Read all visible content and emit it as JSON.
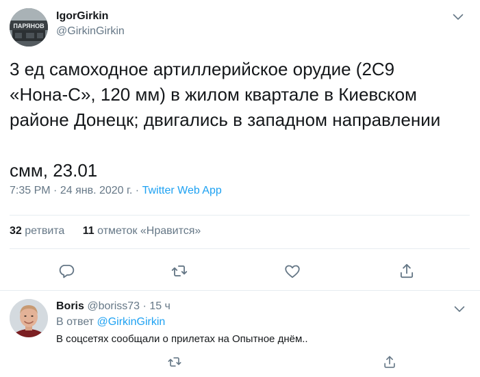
{
  "tweet": {
    "author_name": "IgorGirkin",
    "author_handle": "@GirkinGirkin",
    "avatar_caption": "ПАРЯНОВ",
    "text_lines": [
      "3 ед самоходное артиллерийское орудие (2С9",
      "«Нона-С», 120 мм) в жилом квартале в Киевском",
      "районе Донецк; двигались в западном направлении",
      "смм, 23.01"
    ],
    "time": "7:35 PM",
    "date": "24 янв. 2020 г.",
    "separator": "·",
    "app": "Twitter Web App",
    "retweet_count": "32",
    "retweet_label": "ретвита",
    "like_count": "11",
    "like_label": "отметок «Нравится»"
  },
  "icons": {
    "reply": "reply-icon",
    "retweet": "retweet-icon",
    "like": "heart-icon",
    "share": "share-icon",
    "more": "chevron-down-icon"
  },
  "reply": {
    "name": "Boris",
    "handle": "@boriss73",
    "dot": "·",
    "time": "15 ч",
    "reply_to_prefix": "В ответ",
    "reply_to_handle": "@GirkinGirkin",
    "text": "В соцсетях сообщали о прилетах на Опытное днём.."
  },
  "colors": {
    "text": "#14171a",
    "secondary": "#657786",
    "accent": "#1da1f2",
    "divider": "#e6ecf0"
  }
}
